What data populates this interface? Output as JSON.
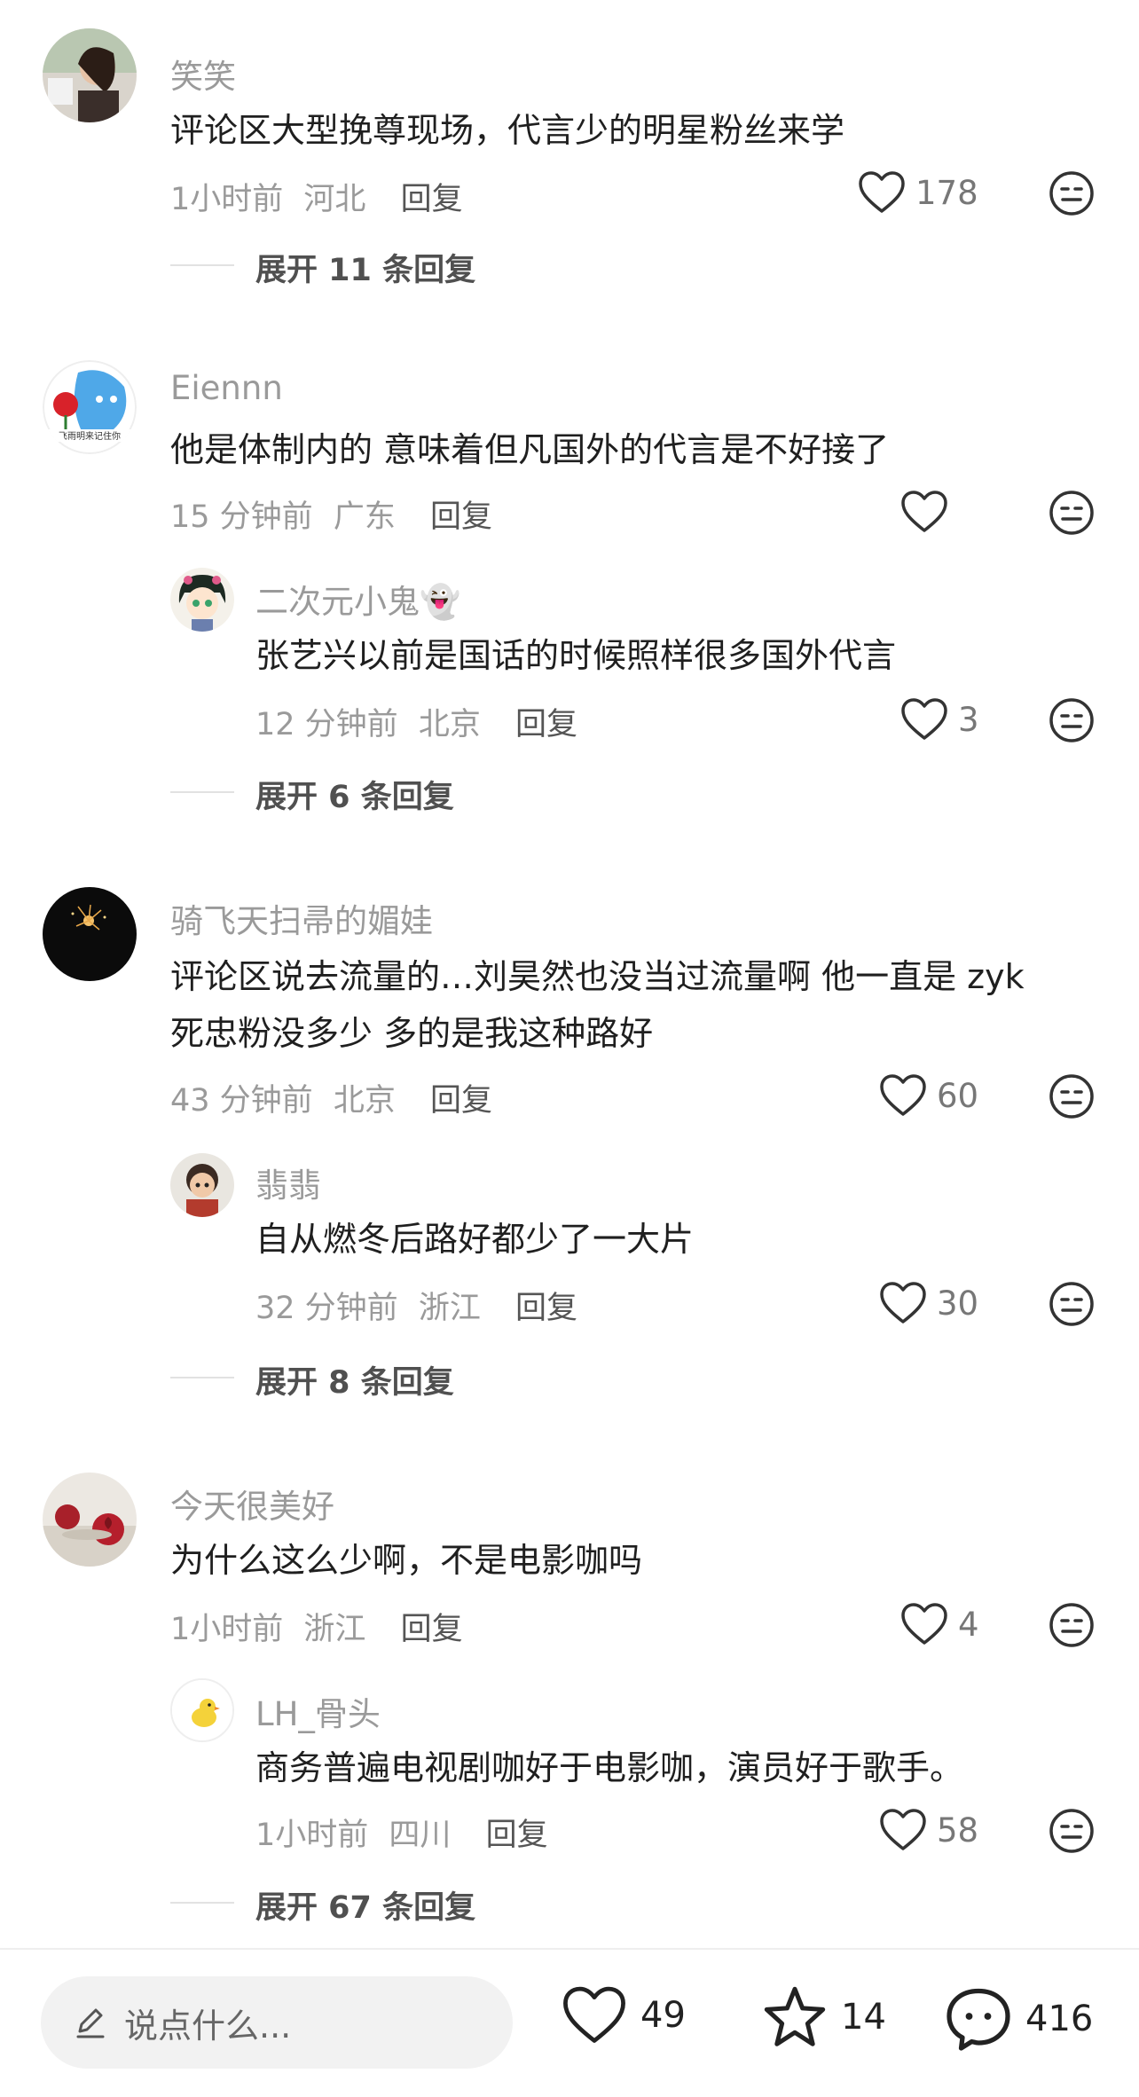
{
  "comments": [
    {
      "user": "笑笑",
      "text": [
        "评论区大型挽尊现场，代言少的明星粉丝来学"
      ],
      "time": "1小时前",
      "location": "河北",
      "reply_label": "回复",
      "likes": "178",
      "expand": "展开 11 条回复"
    },
    {
      "user": "Eiennn",
      "text": [
        "他是体制内的 意味着但凡国外的代言是不好接了"
      ],
      "time": "15 分钟前",
      "location": "广东",
      "reply_label": "回复",
      "likes": "",
      "sub": {
        "user": "二次元小鬼👻",
        "text": [
          "张艺兴以前是国话的时候照样很多国外代言"
        ],
        "time": "12 分钟前",
        "location": "北京",
        "reply_label": "回复",
        "likes": "3"
      },
      "expand": "展开 6 条回复"
    },
    {
      "user": "骑飞天扫帚的媚娃",
      "text": [
        "评论区说去流量的…刘昊然也没当过流量啊  他一直是 zyk",
        "死忠粉没多少  多的是我这种路好"
      ],
      "time": "43 分钟前",
      "location": "北京",
      "reply_label": "回复",
      "likes": "60",
      "sub": {
        "user": "翡翡",
        "text": [
          "自从燃冬后路好都少了一大片"
        ],
        "time": "32 分钟前",
        "location": "浙江",
        "reply_label": "回复",
        "likes": "30"
      },
      "expand": "展开 8 条回复"
    },
    {
      "user": "今天很美好",
      "text": [
        "为什么这么少啊，不是电影咖吗"
      ],
      "time": "1小时前",
      "location": "浙江",
      "reply_label": "回复",
      "likes": "4",
      "sub": {
        "user": "LH_骨头",
        "text": [
          "商务普遍电视剧咖好于电影咖，演员好于歌手。"
        ],
        "time": "1小时前",
        "location": "四川",
        "reply_label": "回复",
        "likes": "58"
      },
      "expand": "展开 67 条回复"
    }
  ],
  "bottom_bar": {
    "input_placeholder": "说点什么...",
    "likes": "49",
    "favorites": "14",
    "comments": "416"
  },
  "icons": {
    "like": "heart-icon",
    "dislike": "dislike-face-icon",
    "favorite": "star-icon",
    "comment": "comment-bubble-icon",
    "edit": "pencil-icon"
  }
}
